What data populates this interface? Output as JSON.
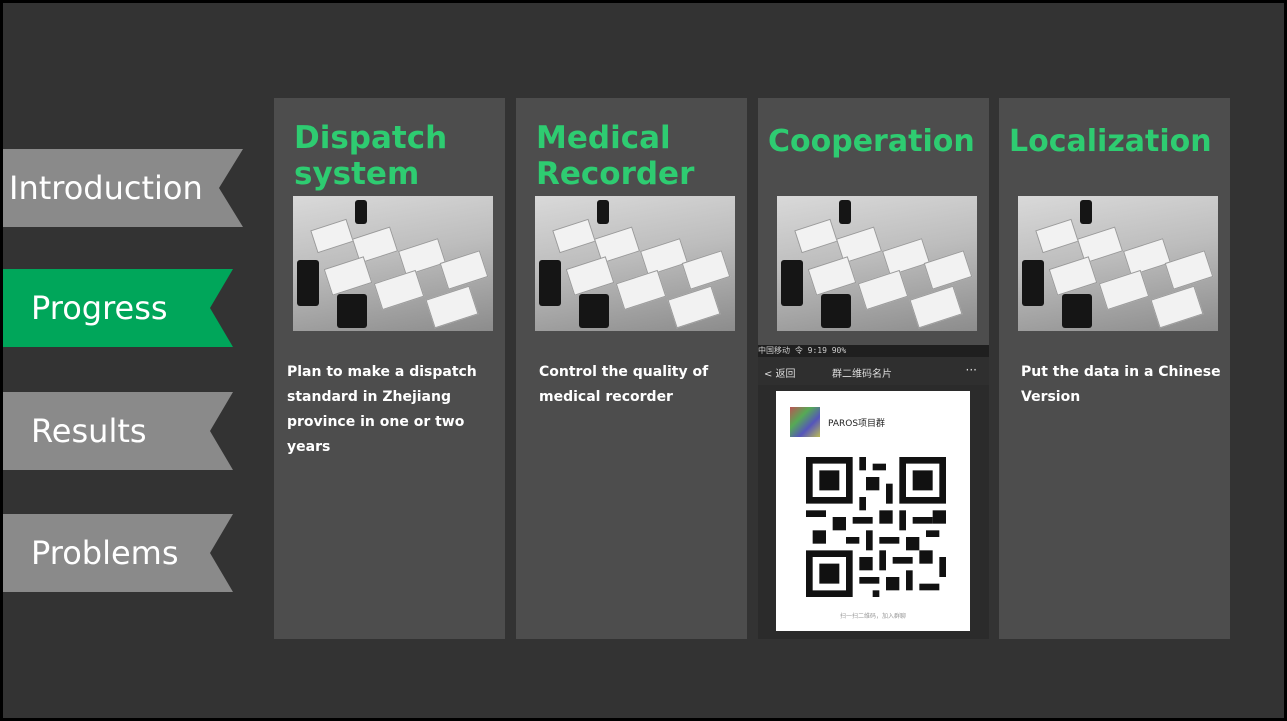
{
  "nav": {
    "items": [
      {
        "label": "Introduction",
        "active": false
      },
      {
        "label": "Progress",
        "active": true
      },
      {
        "label": "Results",
        "active": false
      },
      {
        "label": "Problems",
        "active": false
      }
    ]
  },
  "cards": [
    {
      "title": "Dispatch system",
      "text": "Plan to make a dispatch standard in Zhejiang province in one or two years"
    },
    {
      "title": "Medical Recorder",
      "text": "Control the quality of medical recorder"
    },
    {
      "title": "Cooperation",
      "text": ""
    },
    {
      "title": "Localization",
      "text": "Put the data in a Chinese Version"
    }
  ],
  "phone": {
    "status": "中国移动 令   9:19          90%",
    "back": "< 返回",
    "title": "群二维码名片",
    "more": "···",
    "group_name": "PAROS项目群",
    "hint": "扫一扫二维码，加入群聊"
  },
  "colors": {
    "background": "#333333",
    "card": "#4d4d4d",
    "accent": "#2ecc71",
    "active_tab": "#00a65a",
    "inactive_tab": "#8a8a8a"
  }
}
